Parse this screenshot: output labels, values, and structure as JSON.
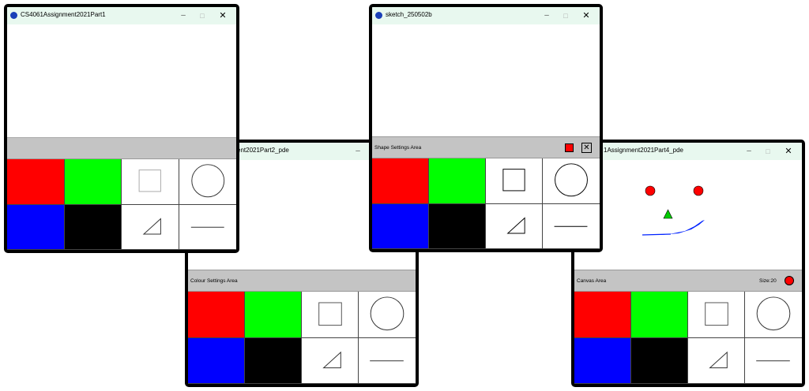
{
  "windows": [
    {
      "title": "CS4061Assignment2021Part1",
      "settings_label": ""
    },
    {
      "title": "ent2021Part2_pde",
      "settings_label": "Colour Settings Area"
    },
    {
      "title": "sketch_250502b",
      "settings_label": "Shape Settings Area"
    },
    {
      "title": "1Assignment2021Part4_pde",
      "settings_label": "Canvas Area",
      "size_label": "Size:20"
    }
  ],
  "window_controls": {
    "minimize": "–",
    "maximize": "□",
    "close": "✕"
  },
  "palette": {
    "colors": [
      {
        "name": "red",
        "hex": "#ff0000"
      },
      {
        "name": "green",
        "hex": "#00ff00"
      },
      {
        "name": "blue",
        "hex": "#0000ff"
      },
      {
        "name": "black",
        "hex": "#000000"
      }
    ],
    "tools": [
      "rectangle-icon",
      "circle-icon",
      "triangle-icon",
      "line-icon"
    ]
  },
  "shape_settings": {
    "fill_color": "#ff0000",
    "clear_icon": "close-box-icon"
  },
  "canvas_settings": {
    "brush_color": "#ff0000"
  },
  "drawing": {
    "eyes_color": "#ff0000",
    "nose_color": "#00cc00",
    "mouth_color": "#0000ff"
  }
}
